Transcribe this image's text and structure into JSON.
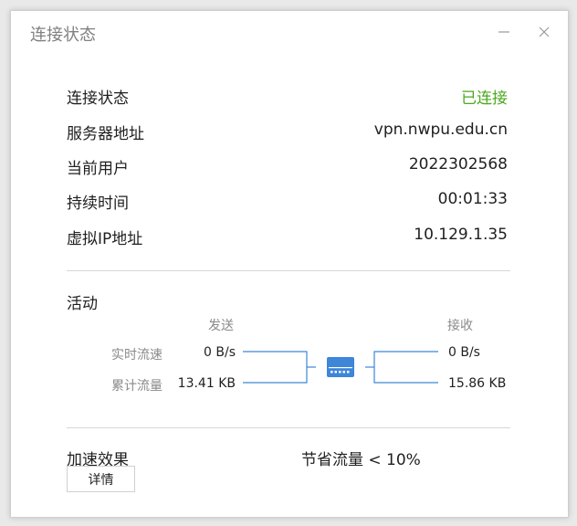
{
  "window": {
    "title": "连接状态"
  },
  "status": {
    "connection_label": "连接状态",
    "connection_value": "已连接",
    "server_label": "服务器地址",
    "server_value": "vpn.nwpu.edu.cn",
    "user_label": "当前用户",
    "user_value": "2022302568",
    "duration_label": "持续时间",
    "duration_value": "00:01:33",
    "ip_label": "虚拟IP地址",
    "ip_value": "10.129.1.35"
  },
  "activity": {
    "title": "活动",
    "send_header": "发送",
    "recv_header": "接收",
    "realtime_label": "实时流速",
    "total_label": "累计流量",
    "send_realtime": "0 B/s",
    "send_total": "13.41 KB",
    "recv_realtime": "0 B/s",
    "recv_total": "15.86 KB"
  },
  "acceleration": {
    "label": "加速效果",
    "value": "节省流量 < 10%",
    "details_button": "详情"
  },
  "colors": {
    "connected": "#4aa81d",
    "accent": "#3d86d8"
  },
  "icons": {
    "minimize": "minimize-icon",
    "close": "close-icon",
    "network": "network-device-icon"
  }
}
